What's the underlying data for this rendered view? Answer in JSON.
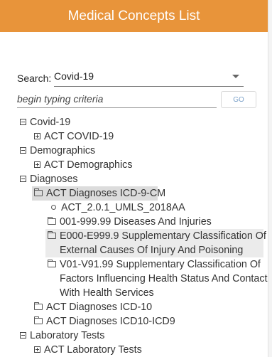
{
  "header": {
    "title": "Medical Concepts List"
  },
  "search": {
    "label": "Search:",
    "value": "Covid-19"
  },
  "criteria": {
    "placeholder": "begin typing criteria",
    "go_label": "GO"
  },
  "tree": [
    {
      "label": "Covid-19",
      "toggle": "minus"
    },
    {
      "label": "ACT COVID-19",
      "toggle": "plus"
    },
    {
      "label": "Demographics",
      "toggle": "minus"
    },
    {
      "label": "ACT Demographics",
      "toggle": "plus"
    },
    {
      "label": "Diagnoses",
      "toggle": "minus"
    },
    {
      "label": "ACT Diagnoses ICD-9-CM",
      "icon": "open-folder-icon"
    },
    {
      "label": "ACT_2.0.1_UMLS_2018AA",
      "icon": "circle-bullet-icon"
    },
    {
      "label": "001-999.99 Diseases And Injuries",
      "icon": "folder-icon"
    },
    {
      "label_line1": "E000-E999.9 Supplementary Classification Of",
      "label_line2": "External Causes Of Injury And Poisoning",
      "icon": "folder-icon"
    },
    {
      "label_line1": "V01-V91.99 Supplementary Classification Of",
      "label_line2": "Factors Influencing Health Status And Contact",
      "label_line3": "With Health Services",
      "icon": "folder-icon"
    },
    {
      "label": "ACT Diagnoses ICD-10",
      "icon": "folder-icon"
    },
    {
      "label": "ACT Diagnoses ICD10-ICD9",
      "icon": "folder-icon"
    },
    {
      "label": "Laboratory Tests",
      "toggle": "minus"
    },
    {
      "label": "ACT Laboratory Tests",
      "toggle": "plus"
    }
  ]
}
